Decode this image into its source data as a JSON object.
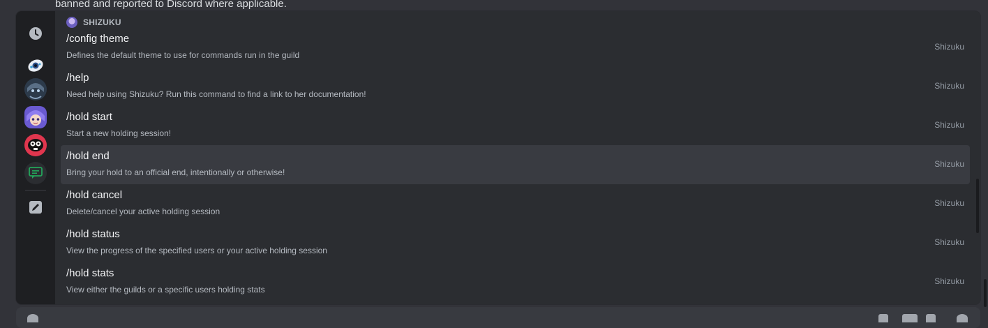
{
  "background_message": {
    "text": "banned and reported to Discord where applicable."
  },
  "rail": {
    "items": [
      {
        "name": "recent-clock-icon"
      },
      {
        "name": "bot-avatar-eye"
      },
      {
        "name": "bot-avatar-girl-dark"
      },
      {
        "name": "bot-avatar-shizuku"
      },
      {
        "name": "bot-avatar-red"
      },
      {
        "name": "app-chat-icon"
      },
      {
        "name": "edit-pencil-icon"
      }
    ]
  },
  "section": {
    "title": "SHIZUKU"
  },
  "commands": [
    {
      "name": "/config theme",
      "description": "Defines the default theme to use for commands run in the guild",
      "source": "Shizuku"
    },
    {
      "name": "/help",
      "description": "Need help using Shizuku? Run this command to find a link to her documentation!",
      "source": "Shizuku"
    },
    {
      "name": "/hold start",
      "description": "Start a new holding session!",
      "source": "Shizuku"
    },
    {
      "name": "/hold end",
      "description": "Bring your hold to an official end, intentionally or otherwise!",
      "source": "Shizuku"
    },
    {
      "name": "/hold cancel",
      "description": "Delete/cancel your active holding session",
      "source": "Shizuku"
    },
    {
      "name": "/hold status",
      "description": "View the progress of the specified users or your active holding session",
      "source": "Shizuku"
    },
    {
      "name": "/hold stats",
      "description": "View either the guilds or a specific users holding stats",
      "source": "Shizuku"
    }
  ],
  "colors": {
    "background": "#323339",
    "popup": "#2b2d31",
    "rail": "#1e1f22",
    "active_row": "#393b41",
    "accent_green": "#23a55a"
  }
}
